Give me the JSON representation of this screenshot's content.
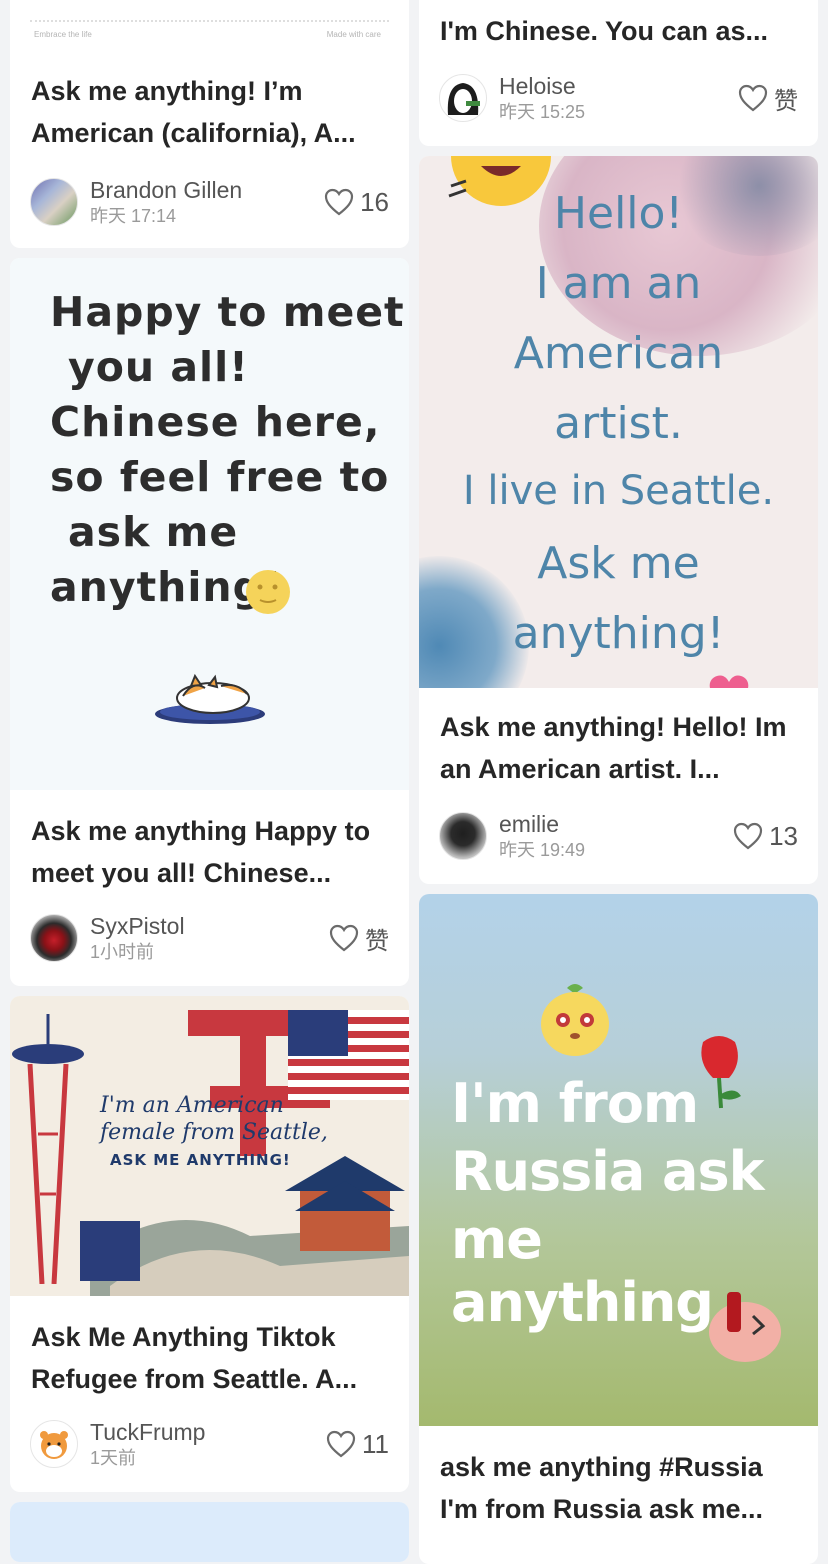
{
  "cards": [
    {
      "image_text_left": "Embrace the life",
      "image_text_right": "Made with care",
      "title": "Ask me anything! I’m American (california), A...",
      "author": "Brandon Gillen",
      "time": "昨天 17:14",
      "likes": "16"
    },
    {
      "image_lines": [
        "Happy to meet",
        "you all!",
        "Chinese here,",
        "so feel free to",
        "ask me",
        "anything!"
      ],
      "title": "Ask me anything Happy to meet you all! Chinese...",
      "author": "SyxPistol",
      "time": "1小时前",
      "likes": "赞"
    },
    {
      "image_lines": [
        "I'm an American",
        "female from Seattle,",
        "ASK ME ANYTHING!"
      ],
      "title": "Ask Me Anything Tiktok Refugee from Seattle. A...",
      "author": "TuckFrump",
      "time": "1天前",
      "likes": "11"
    },
    {
      "title": "I'm Chinese. You can as...",
      "author": "Heloise",
      "time": "昨天 15:25",
      "likes": "赞"
    },
    {
      "image_lines": [
        "Hello!",
        "I am an",
        "American",
        "artist.",
        "I live in Seattle.",
        "Ask me",
        "anything!"
      ],
      "title": "Ask me anything! Hello! Im an American artist. I...",
      "author": "emilie",
      "time": "昨天 19:49",
      "likes": "13"
    },
    {
      "image_lines": [
        "I'm from",
        "Russia ask",
        "me anything"
      ],
      "title": "ask me anything #Russia I'm from Russia ask me..."
    }
  ],
  "colors": {
    "accent_blue": "#5a8fb0",
    "heart_stroke": "#6b6b6b"
  }
}
